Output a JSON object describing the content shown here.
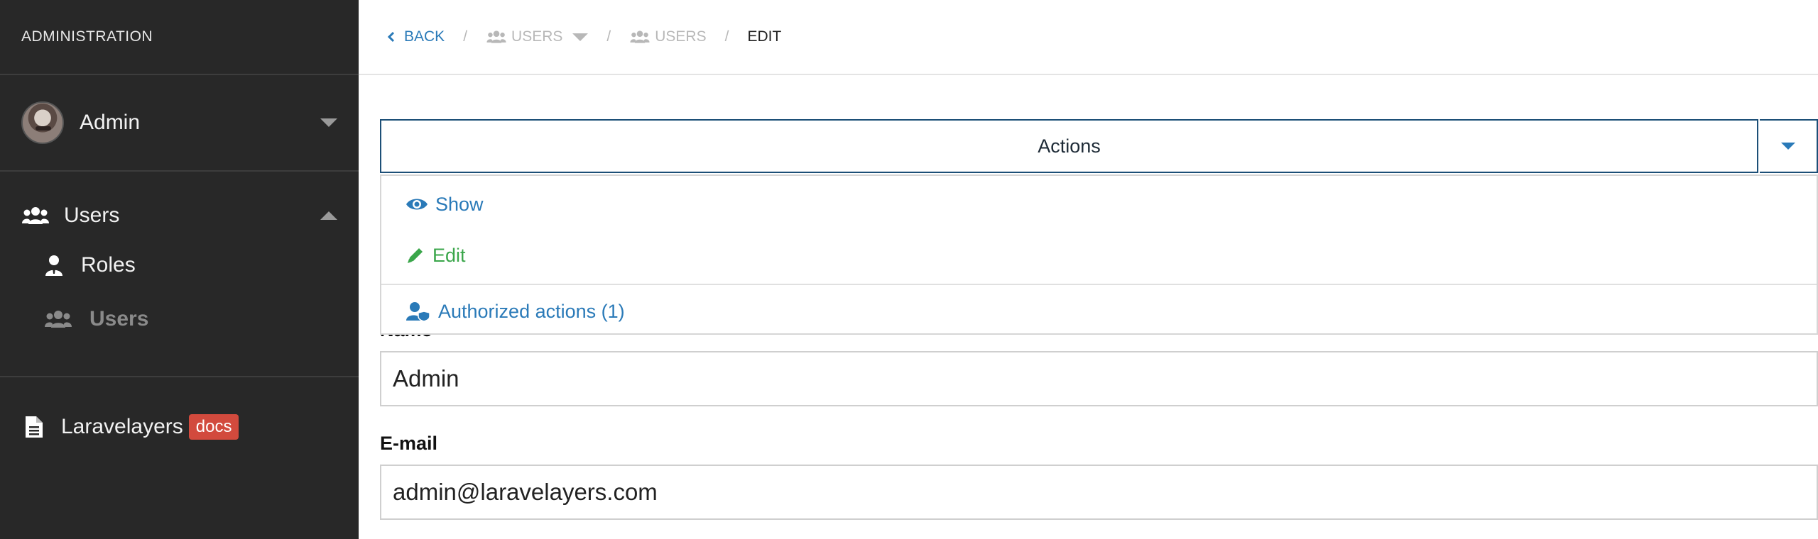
{
  "sidebar": {
    "header": "ADMINISTRATION",
    "user_name": "Admin",
    "menu": {
      "users_label": "Users",
      "roles_label": "Roles",
      "users_sub_label": "Users"
    },
    "docs": {
      "label": "Laravelayers",
      "badge": "docs"
    }
  },
  "breadcrumb": {
    "back": "BACK",
    "users_dropdown": "USERS",
    "users": "USERS",
    "current": "EDIT"
  },
  "actions": {
    "label": "Actions",
    "items": [
      {
        "label": "Show",
        "icon": "eye-icon"
      },
      {
        "label": "Edit",
        "icon": "pencil-icon"
      },
      {
        "label": "Authorized actions (1)",
        "icon": "user-shield-icon"
      }
    ]
  },
  "form": {
    "name_label": "Name",
    "name_value": "Admin",
    "email_label": "E-mail",
    "email_value": "admin@laravelayers.com"
  },
  "colors": {
    "sidebar_bg": "#282828",
    "link_blue": "#2a7ab8",
    "edit_green": "#3aa64a",
    "badge_red": "#d24a3d"
  }
}
